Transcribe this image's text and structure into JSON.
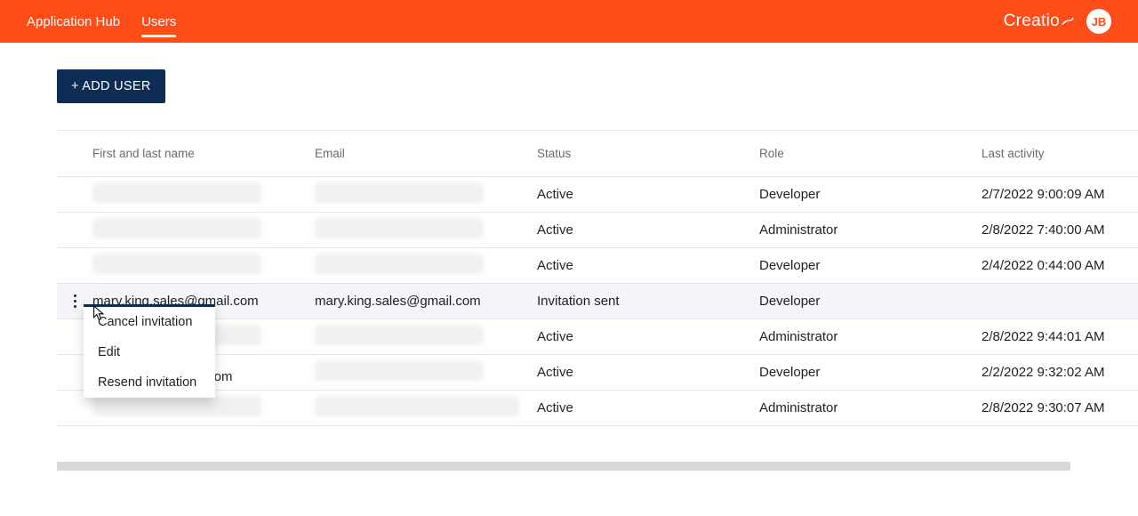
{
  "nav": {
    "app_hub": "Application Hub",
    "users": "Users"
  },
  "brand": "Creatio",
  "avatar_initials": "JB",
  "add_user_button": "+ ADD USER",
  "columns": {
    "name": "First and last name",
    "email": "Email",
    "status": "Status",
    "role": "Role",
    "last_activity": "Last activity"
  },
  "rows": [
    {
      "name_hidden": true,
      "email_hidden": true,
      "status": "Active",
      "role": "Developer",
      "last_activity": "2/7/2022 9:00:09 AM",
      "highlight": false
    },
    {
      "name_hidden": true,
      "email_hidden": true,
      "status": "Active",
      "role": "Administrator",
      "last_activity": "2/8/2022 7:40:00 AM",
      "highlight": false
    },
    {
      "name_hidden": true,
      "email_hidden": true,
      "status": "Active",
      "role": "Developer",
      "last_activity": "2/4/2022 0:44:00 AM",
      "highlight": false
    },
    {
      "name": "mary.king.sales@gmail.com",
      "email": "mary.king.sales@gmail.com",
      "status": "Invitation sent",
      "role": "Developer",
      "last_activity": "",
      "highlight": true,
      "show_kebab": true,
      "show_menu": true
    },
    {
      "name_hidden": true,
      "email_hidden": true,
      "status": "Active",
      "role": "Administrator",
      "last_activity": "2/8/2022 9:44:01 AM",
      "highlight": false,
      "name_tail": ""
    },
    {
      "name_tail": ".com",
      "email_hidden": true,
      "status": "Active",
      "role": "Developer",
      "last_activity": "2/2/2022 9:32:02 AM",
      "highlight": false
    },
    {
      "name_hidden": true,
      "email_hidden": true,
      "status": "Active",
      "role": "Administrator",
      "last_activity": "2/8/2022 9:30:07 AM",
      "highlight": false
    }
  ],
  "context_menu": {
    "cancel": "Cancel invitation",
    "edit": "Edit",
    "resend": "Resend invitation"
  }
}
